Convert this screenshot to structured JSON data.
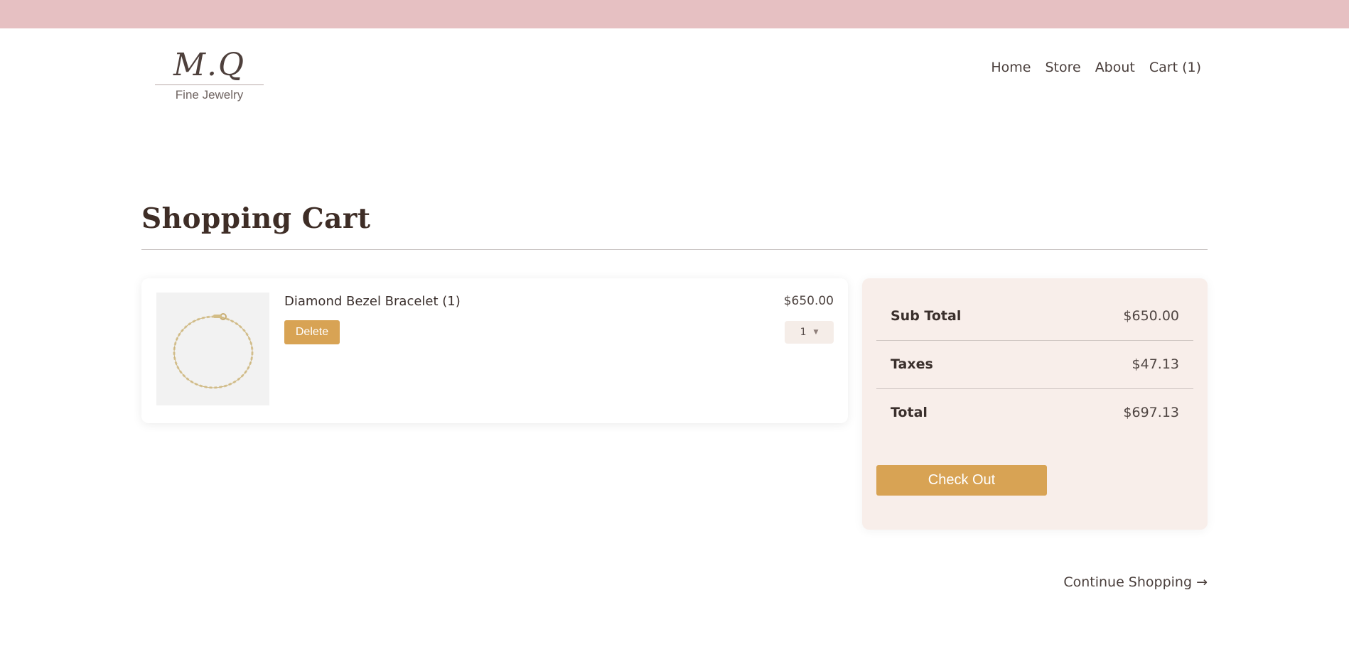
{
  "logo": {
    "mark": "M.Q",
    "subtitle": "Fine Jewelry"
  },
  "nav": {
    "items": [
      {
        "label": "Home"
      },
      {
        "label": "Store"
      },
      {
        "label": "About"
      },
      {
        "label": "Cart (1)"
      }
    ]
  },
  "page": {
    "title": "Shopping Cart"
  },
  "cart": {
    "items": [
      {
        "name": "Diamond Bezel Bracelet (1)",
        "price": "$650.00",
        "delete_label": "Delete",
        "quantity": "1",
        "image_icon": "bracelet-image"
      }
    ]
  },
  "summary": {
    "subtotal_label": "Sub Total",
    "subtotal_value": "$650.00",
    "taxes_label": "Taxes",
    "taxes_value": "$47.13",
    "total_label": "Total",
    "total_value": "$697.13",
    "checkout_label": "Check Out"
  },
  "footer": {
    "continue_label": "Continue Shopping →"
  },
  "colors": {
    "top_bar": "#e6c0c2",
    "accent_button": "#d8a354",
    "summary_bg": "#f8eeea",
    "heading": "#3e2d26"
  }
}
